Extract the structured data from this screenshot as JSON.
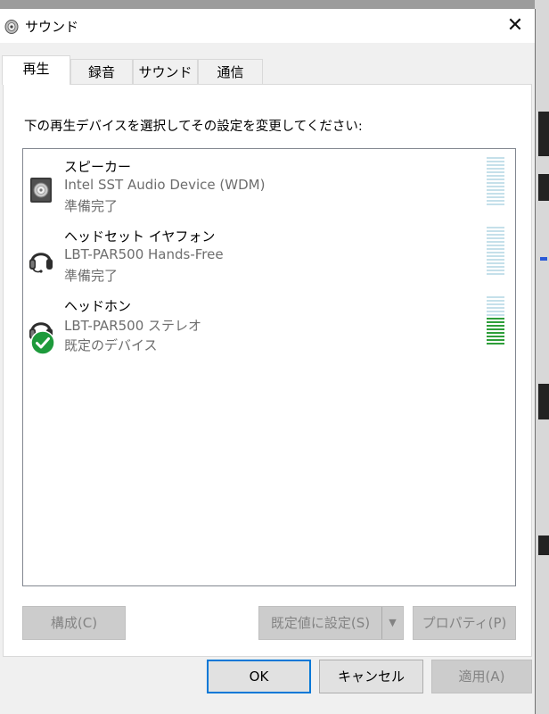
{
  "window": {
    "title": "サウンド",
    "close_icon": "close-icon"
  },
  "tabs": [
    {
      "label": "再生",
      "active": true
    },
    {
      "label": "録音",
      "active": false
    },
    {
      "label": "サウンド",
      "active": false
    },
    {
      "label": "通信",
      "active": false
    }
  ],
  "instruction": "下の再生デバイスを選択してその設定を変更してください:",
  "devices": [
    {
      "name": "スピーカー",
      "description": "Intel SST Audio Device (WDM)",
      "status": "準備完了",
      "icon": "speaker-icon",
      "default": false,
      "level": 0
    },
    {
      "name": "ヘッドセット イヤフォン",
      "description": "LBT-PAR500 Hands-Free",
      "status": "準備完了",
      "icon": "headset-icon",
      "default": false,
      "level": 0
    },
    {
      "name": "ヘッドホン",
      "description": "LBT-PAR500 ステレオ",
      "status": "既定のデバイス",
      "icon": "headphones-icon",
      "default": true,
      "level": 0.6
    }
  ],
  "buttons": {
    "configure": "構成(C)",
    "set_default": "既定値に設定(S)",
    "properties": "プロパティ(P)",
    "ok": "OK",
    "cancel": "キャンセル",
    "apply": "適用(A)"
  },
  "colors": {
    "meter_idle": "#c5e0ea",
    "meter_active": "#2e9e3a",
    "default_check": "#1d9a3b",
    "focus": "#0078d7"
  }
}
